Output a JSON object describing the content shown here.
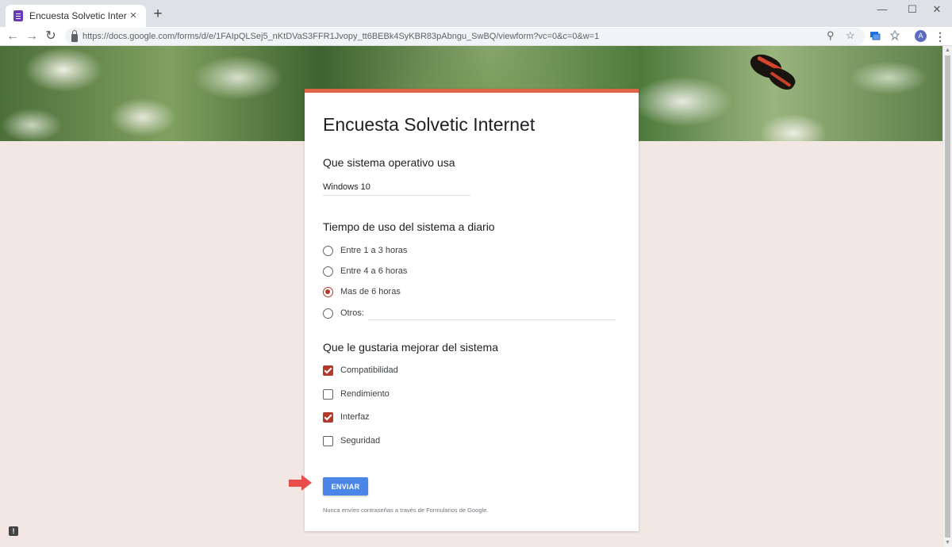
{
  "browser": {
    "tab_title": "Encuesta Solvetic Internet",
    "tab_close": "×",
    "new_tab": "+",
    "window_controls": {
      "minimize": "—",
      "maximize": "☐",
      "close": "✕"
    },
    "url": "https://docs.google.com/forms/d/e/1FAIpQLSej5_nKtDVaS3FFR1Jvopy_tt6BEBk4SyKBR83pAbngu_SwBQ/viewform?vc=0&c=0&w=1",
    "nav": {
      "back": "←",
      "forward": "→",
      "reload": "↻"
    },
    "omnibox_icons": {
      "zoom": "⚲",
      "bookmark": "☆"
    },
    "avatar_letter": "A",
    "menu": "⋮"
  },
  "form": {
    "title": "Encuesta Solvetic Internet",
    "q1": {
      "label": "Que sistema operativo usa",
      "answer": "Windows 10"
    },
    "q2": {
      "label": "Tiempo de uso del sistema a diario",
      "options": [
        "Entre 1 a 3 horas",
        "Entre 4 a 6 horas",
        "Mas de 6 horas",
        "Otros:"
      ],
      "selected": "Mas de 6 horas"
    },
    "q3": {
      "label": "Que le gustaria mejorar del sistema",
      "options": [
        "Compatibilidad",
        "Rendimiento",
        "Interfaz",
        "Seguridad"
      ],
      "checked": [
        "Compatibilidad",
        "Interfaz"
      ]
    },
    "submit_label": "ENVIAR",
    "disclaimer": "Nunca envíes contraseñas a través de Formularios de Google."
  },
  "colors": {
    "accent": "#e06648",
    "selection": "#b33a2a",
    "submit": "#4a86e8",
    "background": "#f3e7e4"
  },
  "feedback_icon": "!"
}
